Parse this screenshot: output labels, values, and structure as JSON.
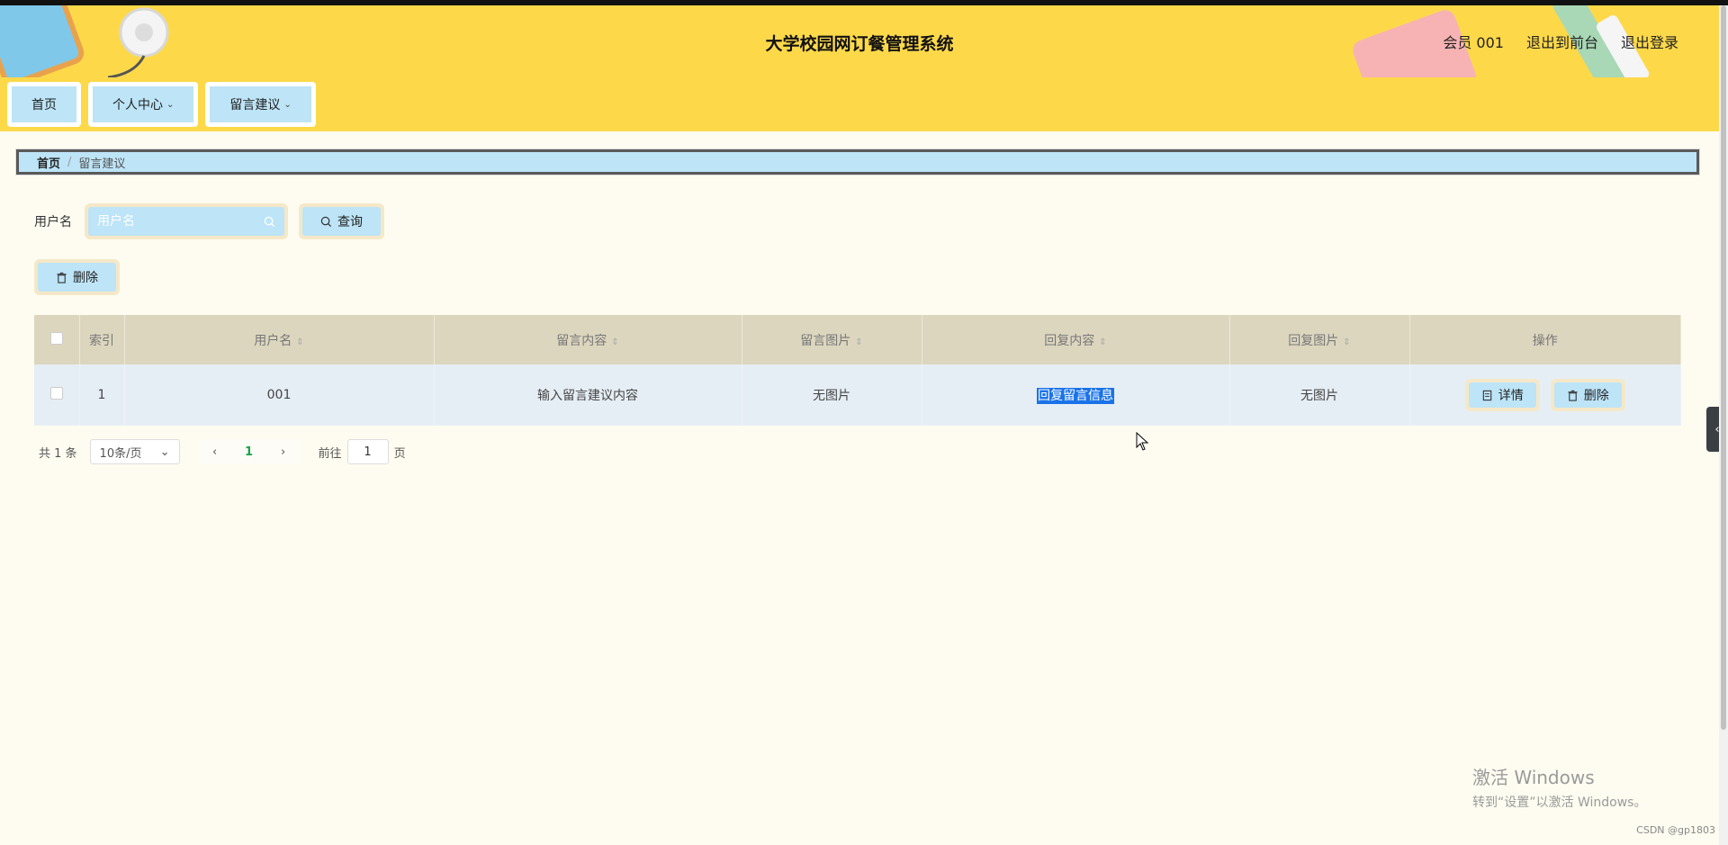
{
  "header": {
    "title": "大学校园网订餐管理系统",
    "member": "会员 001",
    "exit_front": "退出到前台",
    "logout": "退出登录"
  },
  "nav": {
    "home": "首页",
    "personal_center": "个人中心",
    "suggestions": "留言建议"
  },
  "breadcrumb": {
    "home": "首页",
    "current": "留言建议"
  },
  "search": {
    "label": "用户名",
    "placeholder": "用户名",
    "query_button": "查询"
  },
  "toolbar": {
    "delete_button": "删除"
  },
  "table": {
    "headers": [
      "索引",
      "用户名",
      "留言内容",
      "留言图片",
      "回复内容",
      "回复图片",
      "操作"
    ],
    "rows": [
      {
        "index": "1",
        "username": "001",
        "content": "输入留言建议内容",
        "image": "无图片",
        "reply": "回复留言信息",
        "reply_image": "无图片",
        "detail_button": "详情",
        "delete_button": "删除"
      }
    ]
  },
  "pagination": {
    "total": "共 1 条",
    "page_size": "10条/页",
    "current_page": "1",
    "goto_label": "前往",
    "goto_value": "1",
    "page_unit": "页"
  },
  "watermark": {
    "line1": "激活 Windows",
    "line2": "转到“设置”以激活 Windows。"
  },
  "credit": "CSDN @gp1803"
}
